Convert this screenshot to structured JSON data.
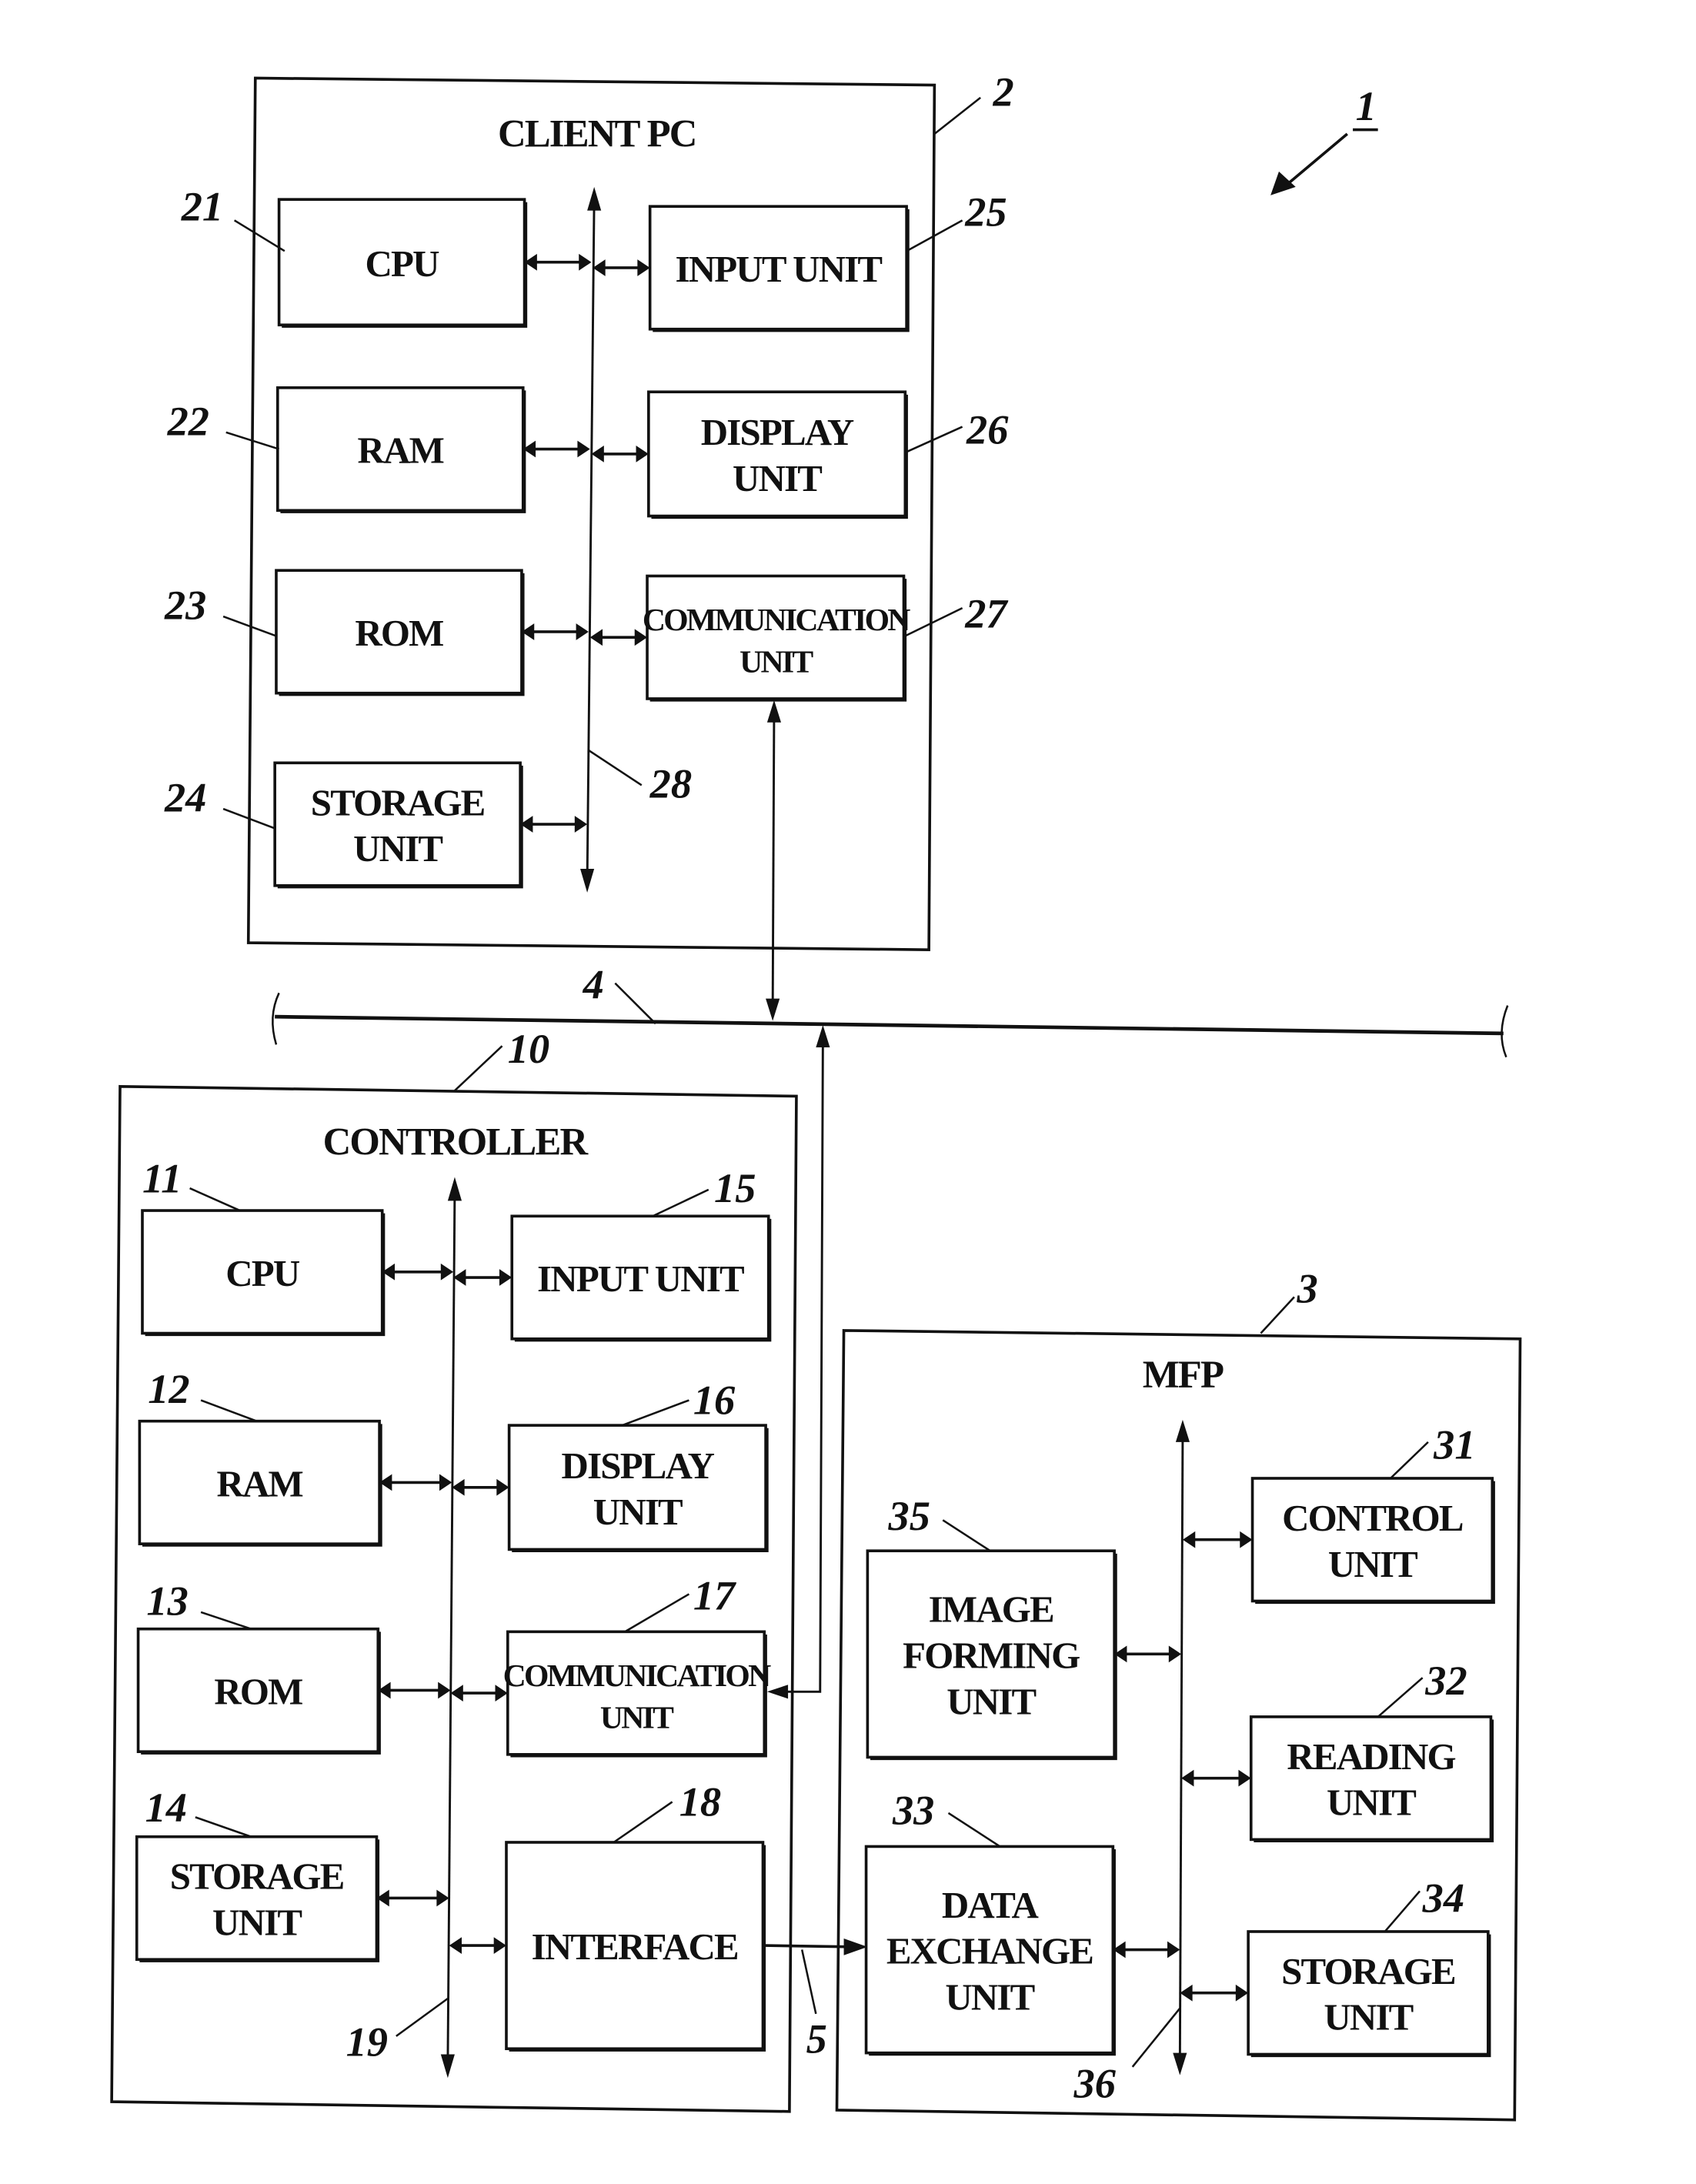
{
  "figure": {
    "system_ref": "1",
    "network": {
      "ref": "4"
    },
    "connection": {
      "ref": "5"
    }
  },
  "client_pc": {
    "title": "CLIENT PC",
    "ref": "2",
    "bus_ref": "28",
    "units": [
      {
        "ref": "21",
        "label": [
          "CPU"
        ]
      },
      {
        "ref": "22",
        "label": [
          "RAM"
        ]
      },
      {
        "ref": "23",
        "label": [
          "ROM"
        ]
      },
      {
        "ref": "24",
        "label": [
          "STORAGE",
          "UNIT"
        ]
      },
      {
        "ref": "25",
        "label": [
          "INPUT UNIT"
        ]
      },
      {
        "ref": "26",
        "label": [
          "DISPLAY",
          "UNIT"
        ]
      },
      {
        "ref": "27",
        "label": [
          "COMMUNICATION",
          "UNIT"
        ]
      }
    ]
  },
  "controller": {
    "title": "CONTROLLER",
    "ref": "10",
    "bus_ref": "19",
    "units": [
      {
        "ref": "11",
        "label": [
          "CPU"
        ]
      },
      {
        "ref": "12",
        "label": [
          "RAM"
        ]
      },
      {
        "ref": "13",
        "label": [
          "ROM"
        ]
      },
      {
        "ref": "14",
        "label": [
          "STORAGE",
          "UNIT"
        ]
      },
      {
        "ref": "15",
        "label": [
          "INPUT UNIT"
        ]
      },
      {
        "ref": "16",
        "label": [
          "DISPLAY",
          "UNIT"
        ]
      },
      {
        "ref": "17",
        "label": [
          "COMMUNICATION",
          "UNIT"
        ]
      },
      {
        "ref": "18",
        "label": [
          "INTERFACE"
        ]
      }
    ]
  },
  "mfp": {
    "title": "MFP",
    "ref": "3",
    "bus_ref": "36",
    "units": [
      {
        "ref": "31",
        "label": [
          "CONTROL",
          "UNIT"
        ]
      },
      {
        "ref": "32",
        "label": [
          "READING",
          "UNIT"
        ]
      },
      {
        "ref": "33",
        "label": [
          "DATA",
          "EXCHANGE",
          "UNIT"
        ]
      },
      {
        "ref": "34",
        "label": [
          "STORAGE",
          "UNIT"
        ]
      },
      {
        "ref": "35",
        "label": [
          "IMAGE",
          "FORMING",
          "UNIT"
        ]
      }
    ]
  }
}
